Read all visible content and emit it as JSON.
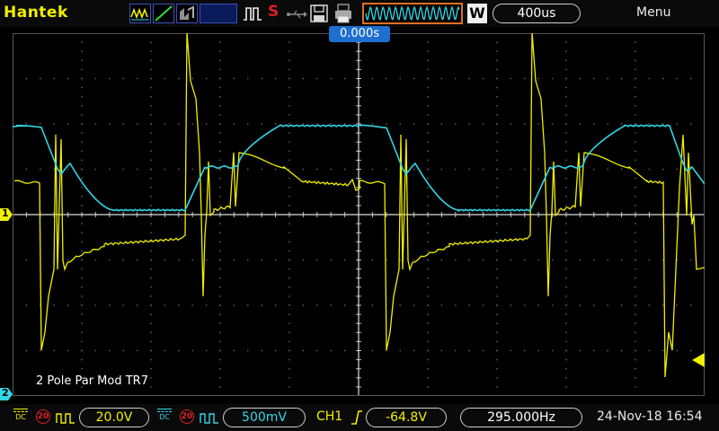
{
  "header": {
    "brand": "Hantek",
    "icons": [
      "dc-coupling-wave-icon",
      "ramp-wave-icon",
      "persist-wave-icon"
    ],
    "trigger_status_label": "S",
    "timebase": "400us",
    "mode_label": "W",
    "menu_label": "Menu"
  },
  "screen": {
    "trigger_time": "0.000s",
    "label": "2 Pole Par Mod TR7",
    "ch1_marker": "1",
    "ch2_marker": "2",
    "colors": {
      "ch1": "#f0f000",
      "ch2": "#30d8e8",
      "grid": "#6a6a6a",
      "trigger_box": "#1f6fd0"
    }
  },
  "footer": {
    "ch1": {
      "coupling": "DC",
      "bw": "20",
      "scale": "20.0V",
      "color": "#f0f000"
    },
    "ch2": {
      "coupling": "DC",
      "bw": "20",
      "scale": "500mV",
      "color": "#30d8e8"
    },
    "trigger": {
      "source": "CH1",
      "level": "-64.8V"
    },
    "frequency": "295.000Hz",
    "datetime": "24-Nov-18 16:54"
  }
}
